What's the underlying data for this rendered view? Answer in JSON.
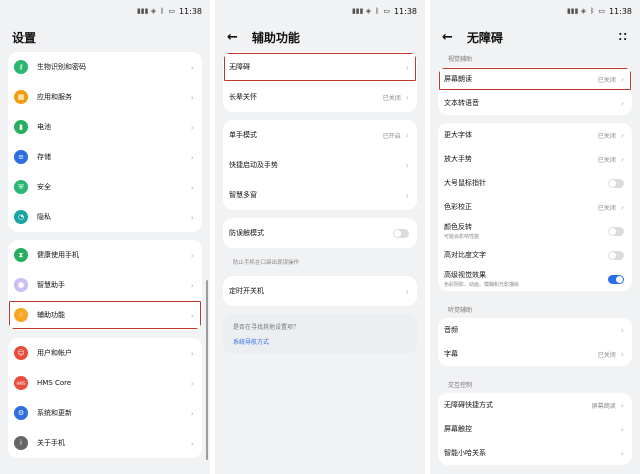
{
  "status": {
    "signal": "4G",
    "speed": "8.3\nK/s",
    "speed2": "4.9\nK/s",
    "speed3": "7.7\nK/s",
    "battery": "69",
    "time": "11:38"
  },
  "screen1": {
    "title": "设置",
    "group1": [
      {
        "label": "生物识别和密码",
        "color": "#2bb673",
        "icon": "key"
      },
      {
        "label": "应用和服务",
        "color": "#f39c12",
        "icon": "grid"
      },
      {
        "label": "电池",
        "color": "#27ae60",
        "icon": "battery"
      },
      {
        "label": "存储",
        "color": "#2d6fe0",
        "icon": "storage"
      },
      {
        "label": "安全",
        "color": "#2bb673",
        "icon": "shield"
      },
      {
        "label": "隐私",
        "color": "#1aa5a5",
        "icon": "lock"
      }
    ],
    "group2": [
      {
        "label": "健康使用手机",
        "color": "#27ae60",
        "icon": "hourglass"
      },
      {
        "label": "智慧助手",
        "color": "#c58af0",
        "icon": "assistant"
      },
      {
        "label": "辅助功能",
        "color": "#f5a623",
        "icon": "hand"
      }
    ],
    "group3": [
      {
        "label": "用户和帐户",
        "color": "#e74c3c",
        "icon": "user"
      },
      {
        "label": "HMS Core",
        "color": "#e74c3c",
        "icon": "hms",
        "icon_text": "HMS"
      },
      {
        "label": "系统和更新",
        "color": "#2d6fe0",
        "icon": "gear"
      },
      {
        "label": "关于手机",
        "color": "#666666",
        "icon": "info"
      }
    ]
  },
  "screen2": {
    "title": "辅助功能",
    "card1": [
      {
        "label": "无障碍",
        "value": ""
      },
      {
        "label": "长辈关怀",
        "value": "已关闭"
      }
    ],
    "card2": [
      {
        "label": "单手模式",
        "value": "已开启"
      },
      {
        "label": "快捷启动及手势",
        "value": ""
      },
      {
        "label": "智慧多窗",
        "value": ""
      }
    ],
    "anti_touch": {
      "label": "防误触模式",
      "note": "防止手机在口袋出现误操作"
    },
    "timer": {
      "label": "定时开关机"
    },
    "tip": {
      "text": "是否在寻找其他设置项？",
      "link": "系统导航方式"
    }
  },
  "screen3": {
    "title": "无障碍",
    "section_vision": "视觉辅助",
    "vision_a": [
      {
        "label": "屏幕朗读",
        "value": "已关闭"
      },
      {
        "label": "文本转语音",
        "value": ""
      }
    ],
    "vision_b": [
      {
        "label": "更大字体",
        "value": "已关闭",
        "type": "chev"
      },
      {
        "label": "放大手势",
        "value": "已关闭",
        "type": "chev"
      },
      {
        "label": "大号鼠标指针",
        "value": "",
        "type": "toggle",
        "on": false
      },
      {
        "label": "色彩校正",
        "value": "已关闭",
        "type": "chev"
      },
      {
        "label": "颜色反转",
        "sub": "可能会影响性能",
        "value": "",
        "type": "toggle",
        "on": false
      },
      {
        "label": "高对比度文字",
        "value": "",
        "type": "toggle",
        "on": false
      },
      {
        "label": "高级视觉效果",
        "sub": "色彩阴影、动画、模糊和光影描绘",
        "value": "",
        "type": "toggle",
        "on": true
      }
    ],
    "section_hearing": "听觉辅助",
    "hearing": [
      {
        "label": "音频",
        "value": ""
      },
      {
        "label": "字幕",
        "value": "已关闭"
      }
    ],
    "section_interaction": "交互控制",
    "interaction": [
      {
        "label": "无障碍快捷方式",
        "value": "屏幕朗读"
      },
      {
        "label": "屏幕触控",
        "value": ""
      },
      {
        "label": "智能小哈关系",
        "value": ""
      }
    ]
  }
}
